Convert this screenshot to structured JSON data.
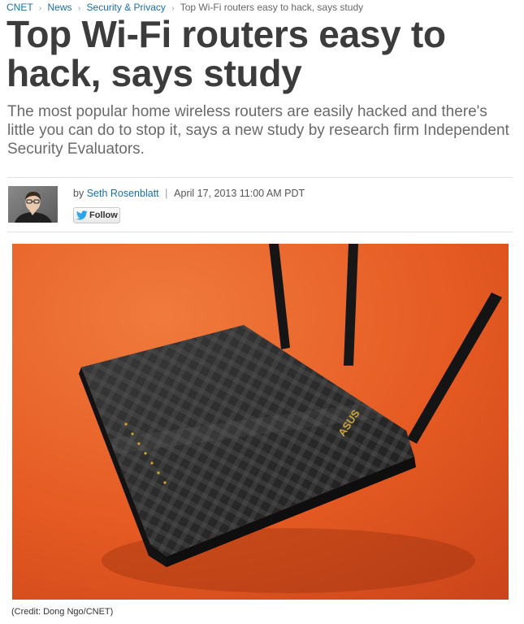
{
  "breadcrumb": {
    "items": [
      "CNET",
      "News",
      "Security & Privacy"
    ],
    "current": "Top Wi-Fi routers easy to hack, says study"
  },
  "article": {
    "headline": "Top Wi-Fi routers easy to hack, says study",
    "dek": "The most popular home wireless routers are easily hacked and there's little you can do to stop it, says a new study by research firm Independent Security Evaluators.",
    "byline_prefix": "by",
    "author": "Seth Rosenblatt",
    "date": "April 17, 2013 11:00 AM PDT",
    "follow_label": "Follow",
    "photo_credit": "(Credit: Dong Ngo/CNET)",
    "router_brand": "ASUS"
  },
  "colors": {
    "link": "#1a6ea8",
    "headline": "#3c3c3c",
    "dek": "#6a6a6a",
    "background_orange": "#e85f24",
    "router_body": "#2a2a2a",
    "twitter": "#2fa4e7"
  },
  "icons": {
    "follow": "twitter-bird-icon",
    "separator": "chevron-right-icon"
  }
}
